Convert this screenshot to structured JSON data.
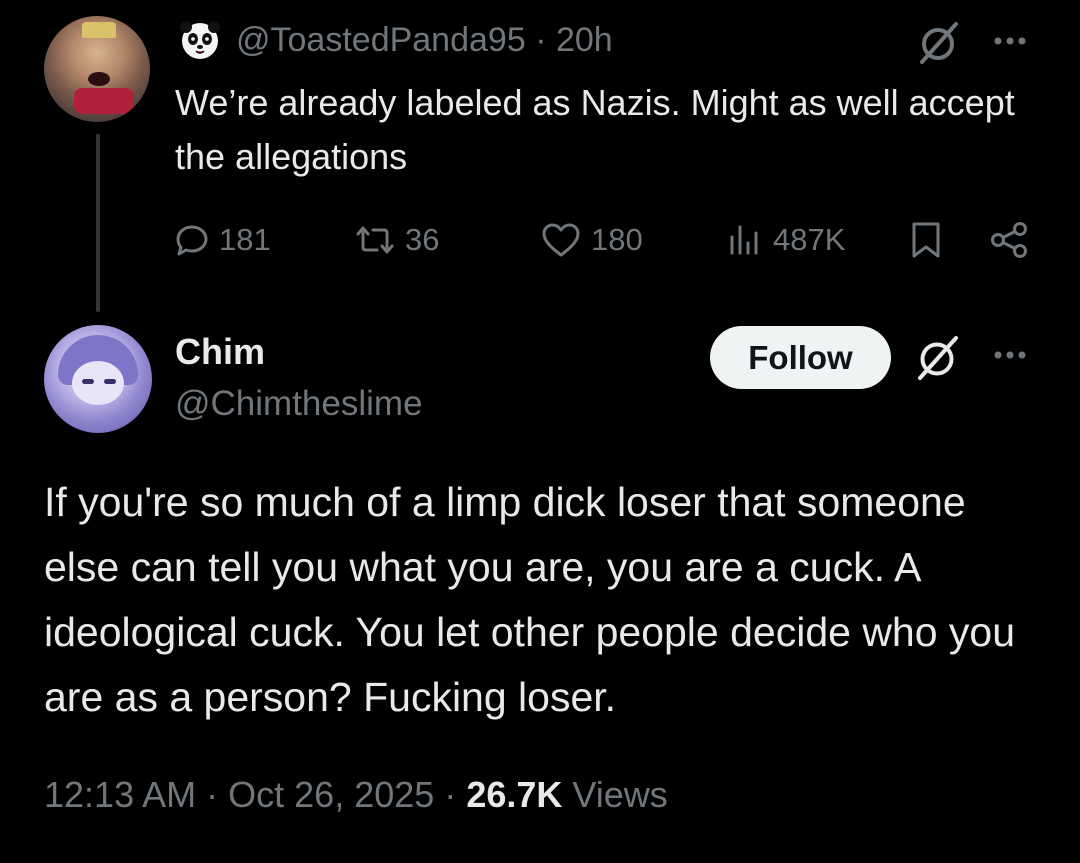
{
  "parent_tweet": {
    "handle": "@ToastedPanda95",
    "separator": "·",
    "time": "20h",
    "text": "We’re already labeled as Nazis. Might as well accept the allegations",
    "icons": {
      "badge": "panda-emoji-icon",
      "grok": "grok-icon",
      "more": "more-dots-icon"
    },
    "actions": {
      "replies": "181",
      "reposts": "36",
      "likes": "180",
      "views": "487K"
    }
  },
  "main_tweet": {
    "display_name": "Chim",
    "handle": "@Chimtheslime",
    "follow_label": "Follow",
    "text": "If you're so much of a limp dick loser that someone else can tell you what you are, you are a cuck. A ideological cuck. You let other people decide who you are as a person? Fucking loser.",
    "time": "12:13 AM",
    "sep1": "·",
    "date": "Oct 26, 2025",
    "sep2": "·",
    "views_count": "26.7K",
    "views_label": "Views"
  },
  "colors": {
    "background": "#000000",
    "text_primary": "#e7e9ea",
    "text_secondary": "#71767b",
    "follow_bg": "#eff3f4",
    "follow_text": "#0f1419",
    "thread_line": "#333639"
  }
}
